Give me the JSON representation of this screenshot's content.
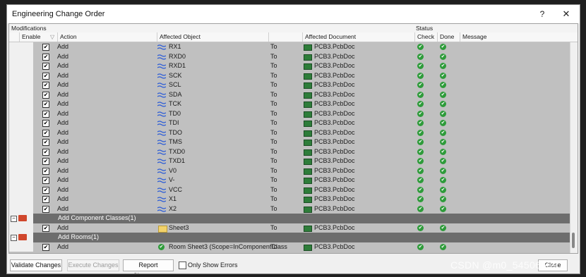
{
  "window": {
    "title": "Engineering Change Order",
    "help_label": "?",
    "close_label": "✕"
  },
  "header": {
    "group_modifications": "Modifications",
    "group_status": "Status",
    "columns": {
      "enable": "Enable",
      "action": "Action",
      "affected_object": "Affected Object",
      "affected_document": "Affected Document",
      "check": "Check",
      "done": "Done",
      "message": "Message"
    }
  },
  "rows": [
    {
      "action": "Add",
      "object": "RX1",
      "to": "To",
      "document": "PCB3.PcbDoc"
    },
    {
      "action": "Add",
      "object": "RXD0",
      "to": "To",
      "document": "PCB3.PcbDoc"
    },
    {
      "action": "Add",
      "object": "RXD1",
      "to": "To",
      "document": "PCB3.PcbDoc"
    },
    {
      "action": "Add",
      "object": "SCK",
      "to": "To",
      "document": "PCB3.PcbDoc"
    },
    {
      "action": "Add",
      "object": "SCL",
      "to": "To",
      "document": "PCB3.PcbDoc"
    },
    {
      "action": "Add",
      "object": "SDA",
      "to": "To",
      "document": "PCB3.PcbDoc"
    },
    {
      "action": "Add",
      "object": "TCK",
      "to": "To",
      "document": "PCB3.PcbDoc"
    },
    {
      "action": "Add",
      "object": "TD0",
      "to": "To",
      "document": "PCB3.PcbDoc"
    },
    {
      "action": "Add",
      "object": "TDI",
      "to": "To",
      "document": "PCB3.PcbDoc"
    },
    {
      "action": "Add",
      "object": "TDO",
      "to": "To",
      "document": "PCB3.PcbDoc"
    },
    {
      "action": "Add",
      "object": "TMS",
      "to": "To",
      "document": "PCB3.PcbDoc"
    },
    {
      "action": "Add",
      "object": "TXD0",
      "to": "To",
      "document": "PCB3.PcbDoc"
    },
    {
      "action": "Add",
      "object": "TXD1",
      "to": "To",
      "document": "PCB3.PcbDoc"
    },
    {
      "action": "Add",
      "object": "V0",
      "to": "To",
      "document": "PCB3.PcbDoc"
    },
    {
      "action": "Add",
      "object": "V-",
      "to": "To",
      "document": "PCB3.PcbDoc"
    },
    {
      "action": "Add",
      "object": "VCC",
      "to": "To",
      "document": "PCB3.PcbDoc"
    },
    {
      "action": "Add",
      "object": "X1",
      "to": "To",
      "document": "PCB3.PcbDoc"
    },
    {
      "action": "Add",
      "object": "X2",
      "to": "To",
      "document": "PCB3.PcbDoc"
    }
  ],
  "group_component_classes": {
    "label": "Add Component Classes(1)",
    "expand": "−"
  },
  "component_class_row": {
    "action": "Add",
    "object": "Sheet3",
    "to": "To",
    "document": "PCB3.PcbDoc"
  },
  "group_rooms": {
    "label": "Add Rooms(1)",
    "expand": "−"
  },
  "room_row": {
    "action": "Add",
    "object": "Room Sheet3 (Scope=InComponentClass",
    "to": "To",
    "document": "PCB3.PcbDoc"
  },
  "footer": {
    "validate": "Validate Changes",
    "execute": "Execute Changes",
    "report": "Report Changes...",
    "only_errors": "Only Show Errors",
    "close": "Close"
  },
  "watermark": "CSDN @m0_54506689",
  "icons": {
    "checked": "✔",
    "net": "net-icon",
    "pcb": "pcb-doc-icon",
    "folder": "folder-icon",
    "room": "room-icon"
  }
}
